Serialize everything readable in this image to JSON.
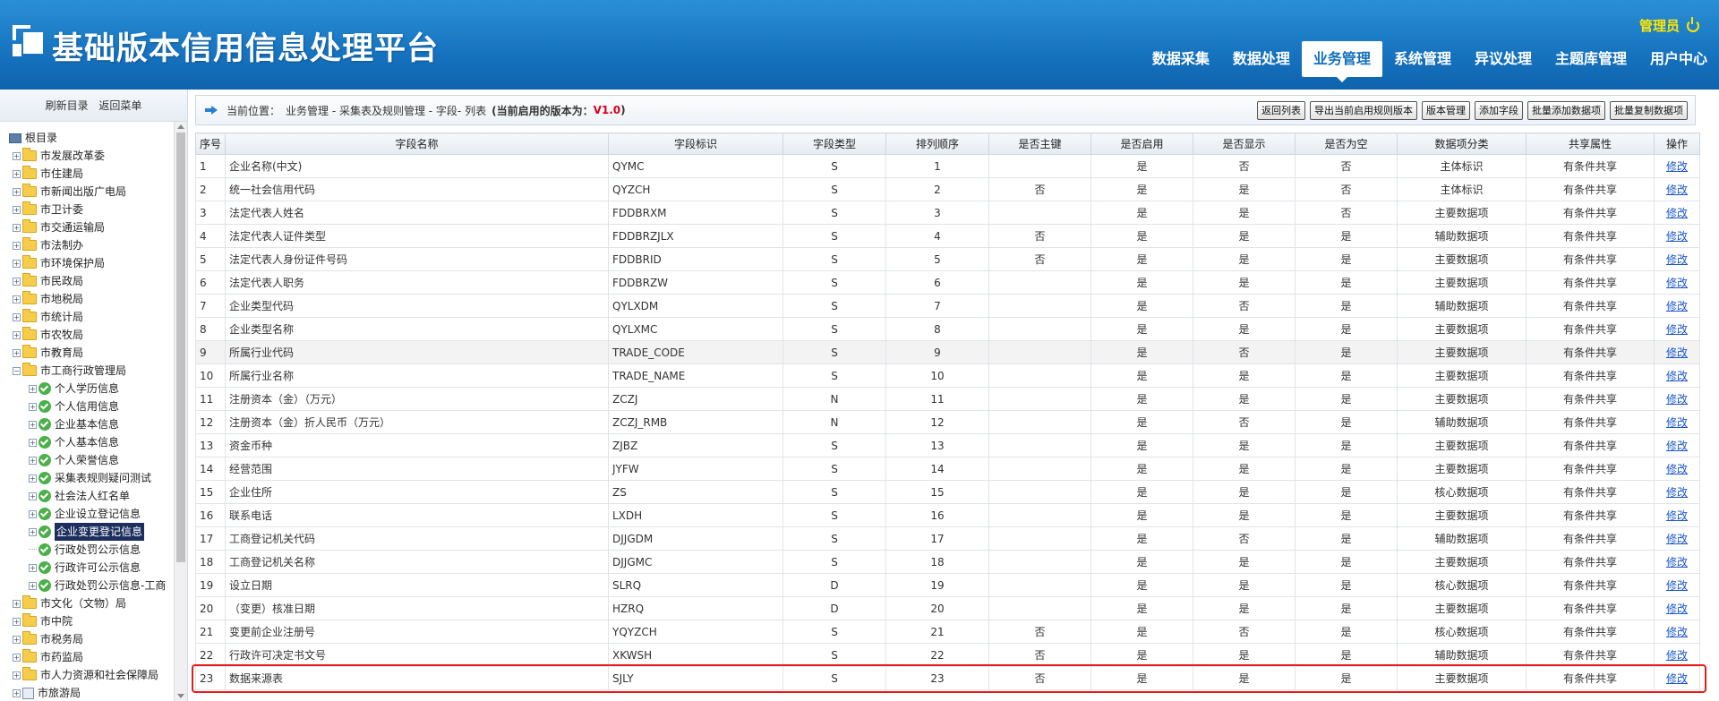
{
  "header": {
    "title": "基础版本信用信息处理平台",
    "user": "管理员",
    "nav": [
      "数据采集",
      "数据处理",
      "业务管理",
      "系统管理",
      "异议处理",
      "主题库管理",
      "用户中心"
    ],
    "active_nav": "业务管理"
  },
  "sidebar": {
    "refresh": "刷新目录",
    "back": "返回菜单",
    "root": "根目录",
    "folders_top": [
      "市发展改革委",
      "市住建局",
      "市新闻出版广电局",
      "市卫计委",
      "市交通运输局",
      "市法制办",
      "市环境保护局",
      "市民政局",
      "市地税局",
      "市统计局",
      "市农牧局",
      "市教育局"
    ],
    "expanded_folder": "市工商行政管理局",
    "children": [
      "个人学历信息",
      "个人信用信息",
      "企业基本信息",
      "个人基本信息",
      "个人荣誉信息",
      "采集表规则疑问测试",
      "社会法人红名单",
      "企业设立登记信息",
      "企业变更登记信息",
      "行政处罚公示信息",
      "行政许可公示信息",
      "行政处罚公示信息-工商"
    ],
    "selected": "企业变更登记信息",
    "folders_bottom": [
      "市文化（文物）局",
      "市中院",
      "市税务局",
      "市药监局",
      "市人力资源和社会保障局",
      "市旅游局"
    ]
  },
  "breadcrumb": {
    "prefix": "当前位置：",
    "path": "业务管理 - 采集表及规则管理 - 字段- 列表",
    "version_label": "(当前启用的版本为：",
    "version": "V1.0",
    "version_suffix": ")"
  },
  "toolbar": [
    "返回列表",
    "导出当前启用规则版本",
    "版本管理",
    "添加字段",
    "批量添加数据项",
    "批量复制数据项"
  ],
  "table": {
    "headers": [
      "序号",
      "字段名称",
      "字段标识",
      "字段类型",
      "排列顺序",
      "是否主键",
      "是否启用",
      "是否显示",
      "是否为空",
      "数据项分类",
      "共享属性",
      "操作"
    ],
    "rows": [
      [
        "1",
        "企业名称(中文)",
        "QYMC",
        "S",
        "1",
        "",
        "是",
        "否",
        "否",
        "主体标识",
        "有条件共享",
        "修改"
      ],
      [
        "2",
        "统一社会信用代码",
        "QYZCH",
        "S",
        "2",
        "否",
        "是",
        "是",
        "否",
        "主体标识",
        "有条件共享",
        "修改"
      ],
      [
        "3",
        "法定代表人姓名",
        "FDDBRXM",
        "S",
        "3",
        "",
        "是",
        "是",
        "否",
        "主要数据项",
        "有条件共享",
        "修改"
      ],
      [
        "4",
        "法定代表人证件类型",
        "FDDBRZJLX",
        "S",
        "4",
        "否",
        "是",
        "是",
        "是",
        "辅助数据项",
        "有条件共享",
        "修改"
      ],
      [
        "5",
        "法定代表人身份证件号码",
        "FDDBRID",
        "S",
        "5",
        "否",
        "是",
        "是",
        "是",
        "主要数据项",
        "有条件共享",
        "修改"
      ],
      [
        "6",
        "法定代表人职务",
        "FDDBRZW",
        "S",
        "6",
        "",
        "是",
        "是",
        "是",
        "主要数据项",
        "有条件共享",
        "修改"
      ],
      [
        "7",
        "企业类型代码",
        "QYLXDM",
        "S",
        "7",
        "",
        "是",
        "否",
        "是",
        "辅助数据项",
        "有条件共享",
        "修改"
      ],
      [
        "8",
        "企业类型名称",
        "QYLXMC",
        "S",
        "8",
        "",
        "是",
        "是",
        "是",
        "主要数据项",
        "有条件共享",
        "修改"
      ],
      [
        "9",
        "所属行业代码",
        "TRADE_CODE",
        "S",
        "9",
        "",
        "是",
        "否",
        "是",
        "主要数据项",
        "有条件共享",
        "修改"
      ],
      [
        "10",
        "所属行业名称",
        "TRADE_NAME",
        "S",
        "10",
        "",
        "是",
        "是",
        "是",
        "主要数据项",
        "有条件共享",
        "修改"
      ],
      [
        "11",
        "注册资本（金）（万元）",
        "ZCZJ",
        "N",
        "11",
        "",
        "是",
        "是",
        "是",
        "主要数据项",
        "有条件共享",
        "修改"
      ],
      [
        "12",
        "注册资本（金）折人民币（万元）",
        "ZCZJ_RMB",
        "N",
        "12",
        "",
        "是",
        "否",
        "是",
        "辅助数据项",
        "有条件共享",
        "修改"
      ],
      [
        "13",
        "资金币种",
        "ZJBZ",
        "S",
        "13",
        "",
        "是",
        "是",
        "是",
        "主要数据项",
        "有条件共享",
        "修改"
      ],
      [
        "14",
        "经营范围",
        "JYFW",
        "S",
        "14",
        "",
        "是",
        "是",
        "是",
        "主要数据项",
        "有条件共享",
        "修改"
      ],
      [
        "15",
        "企业住所",
        "ZS",
        "S",
        "15",
        "",
        "是",
        "是",
        "是",
        "核心数据项",
        "有条件共享",
        "修改"
      ],
      [
        "16",
        "联系电话",
        "LXDH",
        "S",
        "16",
        "",
        "是",
        "是",
        "是",
        "主要数据项",
        "有条件共享",
        "修改"
      ],
      [
        "17",
        "工商登记机关代码",
        "DJJGDM",
        "S",
        "17",
        "",
        "是",
        "否",
        "是",
        "辅助数据项",
        "有条件共享",
        "修改"
      ],
      [
        "18",
        "工商登记机关名称",
        "DJJGMC",
        "S",
        "18",
        "",
        "是",
        "是",
        "是",
        "主要数据项",
        "有条件共享",
        "修改"
      ],
      [
        "19",
        "设立日期",
        "SLRQ",
        "D",
        "19",
        "",
        "是",
        "是",
        "是",
        "核心数据项",
        "有条件共享",
        "修改"
      ],
      [
        "20",
        "（变更）核准日期",
        "HZRQ",
        "D",
        "20",
        "",
        "是",
        "是",
        "是",
        "主要数据项",
        "有条件共享",
        "修改"
      ],
      [
        "21",
        "变更前企业注册号",
        "YQYZCH",
        "S",
        "21",
        "否",
        "是",
        "否",
        "是",
        "核心数据项",
        "有条件共享",
        "修改"
      ],
      [
        "22",
        "行政许可决定书文号",
        "XKWSH",
        "S",
        "22",
        "否",
        "是",
        "是",
        "是",
        "辅助数据项",
        "有条件共享",
        "修改"
      ],
      [
        "23",
        "数据来源表",
        "SJLY",
        "S",
        "23",
        "否",
        "是",
        "是",
        "是",
        "主要数据项",
        "有条件共享",
        "修改"
      ]
    ]
  },
  "colors": {
    "header_blue": "#1673bf",
    "version_red": "#d9001b",
    "highlight_red": "#e81b1b",
    "user_yellow": "#ffe600"
  }
}
